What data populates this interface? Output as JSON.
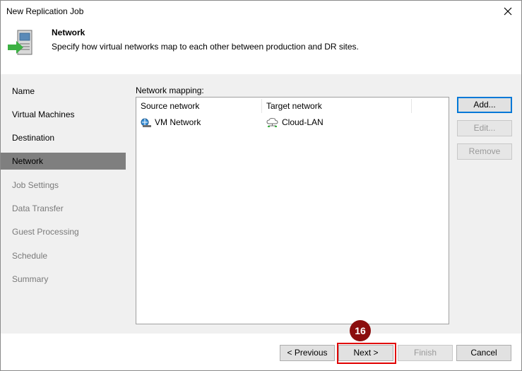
{
  "window": {
    "title": "New Replication Job"
  },
  "header": {
    "title": "Network",
    "description": "Specify how virtual networks map to each other between production and DR sites."
  },
  "nav": {
    "items": [
      {
        "label": "Name",
        "state": "normal"
      },
      {
        "label": "Virtual Machines",
        "state": "normal"
      },
      {
        "label": "Destination",
        "state": "normal"
      },
      {
        "label": "Network",
        "state": "active"
      },
      {
        "label": "Job Settings",
        "state": "disabled"
      },
      {
        "label": "Data Transfer",
        "state": "disabled"
      },
      {
        "label": "Guest Processing",
        "state": "disabled"
      },
      {
        "label": "Schedule",
        "state": "disabled"
      },
      {
        "label": "Summary",
        "state": "disabled"
      }
    ]
  },
  "mapping": {
    "label": "Network mapping:",
    "columns": [
      "Source network",
      "Target network"
    ],
    "rows": [
      {
        "source": "VM Network",
        "target": "Cloud-LAN"
      }
    ]
  },
  "side_buttons": {
    "add": "Add...",
    "edit": "Edit...",
    "remove": "Remove"
  },
  "footer": {
    "previous": "< Previous",
    "next": "Next >",
    "finish": "Finish",
    "cancel": "Cancel"
  },
  "annotation": {
    "step": "16",
    "color": "#8b0d0d",
    "box_color": "#e00000"
  }
}
